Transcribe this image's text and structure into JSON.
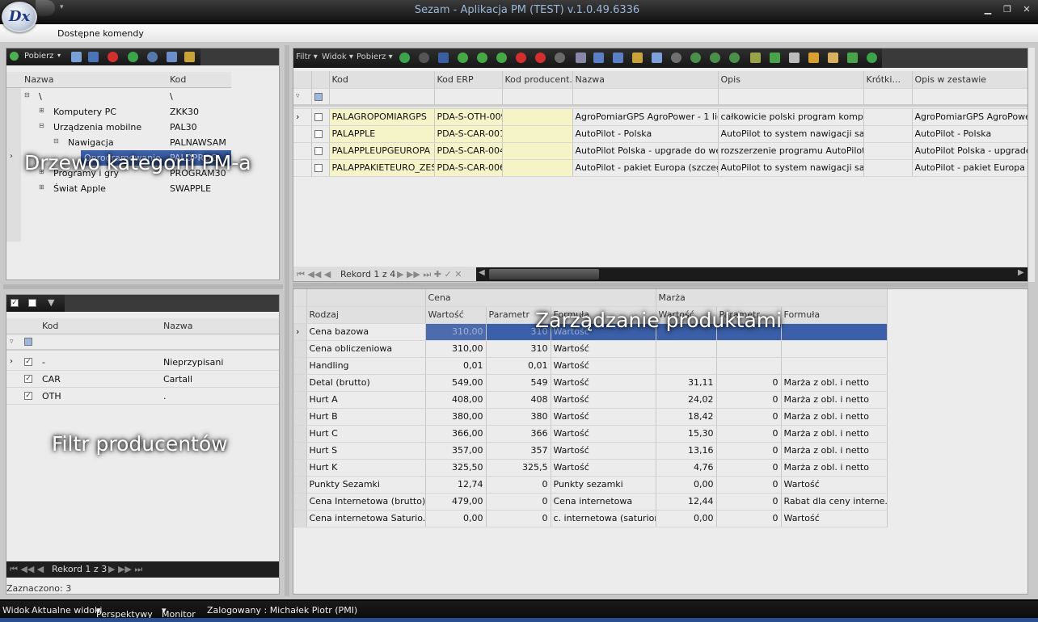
{
  "app": {
    "title": "Sezam - Aplikacja PM (TEST) v.1.0.49.6336",
    "logo_text": "Dx",
    "menu": "Dostępne komendy"
  },
  "colors": {
    "frame": "#c9c9c9",
    "accent": "#3a6fc8",
    "highlight_row": "#3b5fa8",
    "status_line": "#2a4f90"
  },
  "tree_panel": {
    "toolbar": {
      "pobierz": "Pobierz"
    },
    "columns": [
      "Nazwa",
      "Kod"
    ],
    "rows": [
      {
        "name": "\\",
        "code": "\\"
      },
      {
        "name": "Komputery PC",
        "code": "ZKK30"
      },
      {
        "name": "Urządzenia mobilne",
        "code": "PAL30"
      },
      {
        "name": "Nawigacja",
        "code": "PALNAWSAM"
      },
      {
        "name": "Oprogramowanie",
        "code": "PALOPROG"
      },
      {
        "name": "Programy i gry",
        "code": "PROGRAM30"
      },
      {
        "name": "Świat Apple",
        "code": "SWAPPLE"
      }
    ],
    "overlay": "Drzewo kategorii PM-a"
  },
  "producer_panel": {
    "columns": [
      "Kod",
      "Nazwa"
    ],
    "rows": [
      {
        "code": "-",
        "name": "Nieprzypisani"
      },
      {
        "code": "CAR",
        "name": "Cartall"
      },
      {
        "code": "OTH",
        "name": "."
      }
    ],
    "record": "Rekord 1 z 3",
    "selected": "Zaznaczono: 3",
    "overlay": "Filtr producentów"
  },
  "products_panel": {
    "toolbar": {
      "filtr": "Filtr",
      "widok": "Widok",
      "pobierz": "Pobierz"
    },
    "columns": [
      "Kod",
      "Kod ERP",
      "Kod producent...",
      "Nazwa",
      "Opis",
      "Krótki...",
      "Opis w zestawie"
    ],
    "rows": [
      {
        "kod": "PALAGROPOMIARGPS",
        "erp": "PDA-S-OTH-009",
        "prod": "",
        "nazwa": "AgroPomiarGPS AgroPower - 1 lic...",
        "opis": "całkowicie polski program komput...",
        "krotki": "",
        "zestaw": "AgroPomiarGPS AgroPower -"
      },
      {
        "kod": "PALAPPLE",
        "erp": "PDA-S-CAR-001",
        "prod": "",
        "nazwa": "AutoPilot - Polska",
        "opis": "AutoPilot to system nawigacji sam...",
        "krotki": "",
        "zestaw": "AutoPilot - Polska"
      },
      {
        "kod": "PALAPPLEUPGEUROPA",
        "erp": "PDA-S-CAR-004",
        "prod": "",
        "nazwa": "AutoPilot Polska - upgrade do wer...",
        "opis": "rozszerzenie programu AutoPilot ...",
        "krotki": "",
        "zestaw": "AutoPilot Polska - upgrade d"
      },
      {
        "kod": "PALAPPAKIETEURO_ZEST",
        "erp": "PDA-S-CAR-006",
        "prod": "",
        "nazwa": "AutoPilot - pakiet Europa (szczeg...",
        "opis": "AutoPilot to system nawigacji sam...",
        "krotki": "",
        "zestaw": "AutoPilot - pakiet Europa (sz"
      }
    ],
    "record": "Rekord 1 z 4",
    "overlay": "Zarządzanie produktami"
  },
  "price_panel": {
    "groups": {
      "cena": "Cena",
      "marza": "Marża"
    },
    "columns": [
      "Rodzaj",
      "Wartość",
      "Parametr",
      "Formuła",
      "Wartość",
      "Parametr",
      "Formuła"
    ],
    "rows": [
      [
        "Cena bazowa",
        "310,00",
        "310",
        "Wartość",
        "",
        "",
        ""
      ],
      [
        "Cena obliczeniowa",
        "310,00",
        "310",
        "Wartość",
        "",
        "",
        ""
      ],
      [
        "Handling",
        "0,01",
        "0,01",
        "Wartość",
        "",
        "",
        ""
      ],
      [
        "Detal (brutto)",
        "549,00",
        "549",
        "Wartość",
        "31,11",
        "0",
        "Marża z obl. i netto"
      ],
      [
        "Hurt A",
        "408,00",
        "408",
        "Wartość",
        "24,02",
        "0",
        "Marża z obl. i netto"
      ],
      [
        "Hurt B",
        "380,00",
        "380",
        "Wartość",
        "18,42",
        "0",
        "Marża z obl. i netto"
      ],
      [
        "Hurt C",
        "366,00",
        "366",
        "Wartość",
        "15,30",
        "0",
        "Marża z obl. i netto"
      ],
      [
        "Hurt S",
        "357,00",
        "357",
        "Wartość",
        "13,16",
        "0",
        "Marża z obl. i netto"
      ],
      [
        "Hurt K",
        "325,50",
        "325,5",
        "Wartość",
        "4,76",
        "0",
        "Marża z obl. i netto"
      ],
      [
        "Punkty Sezamki",
        "12,74",
        "0",
        "Punkty sezamki",
        "0,00",
        "0",
        "Wartość"
      ],
      [
        "Cena Internetowa (brutto)",
        "479,00",
        "0",
        "Cena internetowa",
        "12,44",
        "0",
        "Rabat dla ceny interne..."
      ],
      [
        "Cena internetowa Saturio...",
        "0,00",
        "0",
        "c. internetowa (saturion)",
        "0,00",
        "0",
        "Wartość"
      ]
    ]
  },
  "statusbar": {
    "widok": "Widok",
    "aktualne": "Aktualne widoki",
    "perspektywy": "Perspektywy",
    "monitor": "Monitor",
    "user": "Zalogowany : Michałek Piotr (PMI)"
  }
}
